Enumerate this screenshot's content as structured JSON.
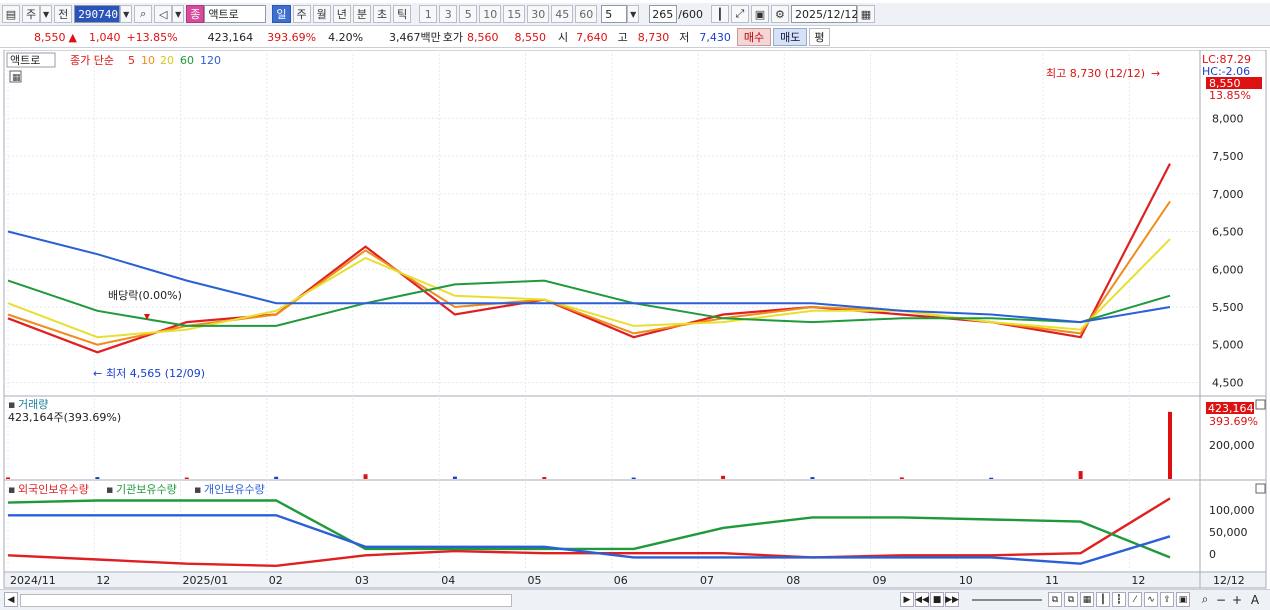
{
  "toolbar": {
    "market": "주",
    "prev_label": "전",
    "code": "290740",
    "name_badge": "종",
    "stock_name": "액트로",
    "periods": [
      "일",
      "주",
      "월",
      "년",
      "분",
      "초",
      "틱"
    ],
    "active_period": "일",
    "minute_steps": [
      "1",
      "3",
      "5",
      "10",
      "15",
      "30",
      "45",
      "60"
    ],
    "interval_value": "5",
    "count": "265",
    "count_total": "/600",
    "date": "2025/12/12"
  },
  "quote": {
    "price": "8,550",
    "change": "1,040",
    "change_pct": "+13.85%",
    "volume": "423,164",
    "volume_ratio": "393.69%",
    "turnover_rate": "4.20%",
    "amount": "3,467백만",
    "ask_label": "호가",
    "ask": "8,560",
    "bid": "8,550",
    "open_label": "시",
    "open": "7,640",
    "high_label": "고",
    "high": "8,730",
    "low_label": "저",
    "low": "7,430",
    "buy_label": "매수",
    "sell_label": "매도",
    "avg_label": "평"
  },
  "price_panel": {
    "stock_label": "액트로",
    "legend_prefix": "종가 단순",
    "ma_periods": [
      {
        "label": "5",
        "color": "#e02020"
      },
      {
        "label": "10",
        "color": "#f08c1a"
      },
      {
        "label": "20",
        "color": "#e8e030"
      },
      {
        "label": "60",
        "color": "#1f9a3a"
      },
      {
        "label": "120",
        "color": "#2a5fd6"
      }
    ],
    "lc": "LC:87.29",
    "hc": "HC:-2.06",
    "price_tag": "8,550",
    "price_tag_pct": "13.85%",
    "annotation_high": "최고 8,730 (12/12)",
    "annotation_low": "최저 4,565 (12/09)",
    "annotation_dividend": "배당락(0.00%)",
    "y_ticks": [
      {
        "value": 8000,
        "label": "8,000"
      },
      {
        "value": 7500,
        "label": "7,500"
      },
      {
        "value": 7000,
        "label": "7,000"
      },
      {
        "value": 6500,
        "label": "6,500"
      },
      {
        "value": 6000,
        "label": "6,000"
      },
      {
        "value": 5500,
        "label": "5,500"
      },
      {
        "value": 5000,
        "label": "5,000"
      },
      {
        "value": 4500,
        "label": "4,500"
      }
    ]
  },
  "volume_panel": {
    "title": "거래량",
    "value_label": "423,164주(393.69%)",
    "tag": "423,164",
    "tag_pct": "393.69%",
    "y_tick": "200,000"
  },
  "holding_panel": {
    "legend": [
      {
        "label": "외국인보유수량",
        "color": "#e02020"
      },
      {
        "label": "기관보유수량",
        "color": "#1f9a3a"
      },
      {
        "label": "개인보유수량",
        "color": "#2a5fd6"
      }
    ],
    "y_ticks": [
      "100,000",
      "50,000",
      "0"
    ]
  },
  "x_axis": {
    "labels": [
      "2024/11",
      "12",
      "2025/01",
      "02",
      "03",
      "04",
      "05",
      "06",
      "07",
      "08",
      "09",
      "10",
      "11",
      "12"
    ],
    "right_label": "12/12"
  },
  "colors": {
    "up": "#d11",
    "down": "#1a3fcf",
    "ma5": "#e02020",
    "ma10": "#f08c1a",
    "ma20": "#e8e030",
    "ma60": "#1f9a3a",
    "ma120": "#2a5fd6"
  },
  "chart_data": {
    "type": "line",
    "title": "액트로",
    "x_range": [
      "2024/11",
      "2025/12/12"
    ],
    "price_range": [
      4400,
      8800
    ],
    "series": [
      {
        "name": "5",
        "x": [
          "2024/11",
          "2024/12",
          "2025/01",
          "2025/02",
          "2025/03",
          "2025/04",
          "2025/05",
          "2025/06",
          "2025/07",
          "2025/08",
          "2025/09",
          "2025/10",
          "2025/11",
          "2025/12/12"
        ],
        "values": [
          5350,
          4900,
          5300,
          5400,
          6300,
          5400,
          5600,
          5100,
          5400,
          5500,
          5400,
          5300,
          5100,
          7400
        ]
      },
      {
        "name": "10",
        "x": [
          "2024/11",
          "2024/12",
          "2025/01",
          "2025/02",
          "2025/03",
          "2025/04",
          "2025/05",
          "2025/06",
          "2025/07",
          "2025/08",
          "2025/09",
          "2025/10",
          "2025/11",
          "2025/12/12"
        ],
        "values": [
          5400,
          5000,
          5250,
          5400,
          6250,
          5500,
          5600,
          5150,
          5350,
          5500,
          5450,
          5300,
          5150,
          6900
        ]
      },
      {
        "name": "20",
        "x": [
          "2024/11",
          "2024/12",
          "2025/01",
          "2025/02",
          "2025/03",
          "2025/04",
          "2025/05",
          "2025/06",
          "2025/07",
          "2025/08",
          "2025/09",
          "2025/10",
          "2025/11",
          "2025/12/12"
        ],
        "values": [
          5550,
          5100,
          5200,
          5450,
          6150,
          5650,
          5600,
          5250,
          5300,
          5450,
          5450,
          5300,
          5200,
          6400
        ]
      },
      {
        "name": "60",
        "x": [
          "2024/11",
          "2024/12",
          "2025/01",
          "2025/02",
          "2025/03",
          "2025/04",
          "2025/05",
          "2025/06",
          "2025/07",
          "2025/08",
          "2025/09",
          "2025/10",
          "2025/11",
          "2025/12/12"
        ],
        "values": [
          5850,
          5450,
          5250,
          5250,
          5550,
          5800,
          5850,
          5550,
          5350,
          5300,
          5350,
          5350,
          5300,
          5650
        ]
      },
      {
        "name": "120",
        "x": [
          "2024/11",
          "2024/12",
          "2025/01",
          "2025/02",
          "2025/03",
          "2025/04",
          "2025/05",
          "2025/06",
          "2025/07",
          "2025/08",
          "2025/09",
          "2025/10",
          "2025/11",
          "2025/12/12"
        ],
        "values": [
          6500,
          6200,
          5850,
          5550,
          5550,
          5550,
          5550,
          5550,
          5550,
          5550,
          5450,
          5400,
          5300,
          5500
        ]
      }
    ],
    "volume": {
      "categories": [
        "2024/11",
        "2024/12",
        "2025/01",
        "2025/02",
        "2025/03",
        "2025/04",
        "2025/05",
        "2025/06",
        "2025/07",
        "2025/08",
        "2025/09",
        "2025/10",
        "2025/11",
        "2025/12/12"
      ],
      "values": [
        10000,
        12000,
        9000,
        14000,
        30000,
        15000,
        12000,
        9000,
        20000,
        12000,
        10000,
        8000,
        50000,
        423164
      ],
      "ylim": [
        0,
        460000
      ]
    },
    "holdings": {
      "categories": [
        "2024/11",
        "2024/12",
        "2025/01",
        "2025/02",
        "2025/03",
        "2025/04",
        "2025/05",
        "2025/06",
        "2025/07",
        "2025/08",
        "2025/09",
        "2025/10",
        "2025/11",
        "2025/12/12"
      ],
      "series": [
        {
          "name": "외국인보유수량",
          "values": [
            5000,
            -5000,
            -15000,
            -20000,
            5000,
            15000,
            10000,
            10000,
            10000,
            0,
            5000,
            5000,
            10000,
            140000
          ]
        },
        {
          "name": "기관보유수량",
          "values": [
            130000,
            135000,
            135000,
            135000,
            20000,
            20000,
            20000,
            20000,
            70000,
            95000,
            95000,
            90000,
            85000,
            0
          ]
        },
        {
          "name": "개인보유수량",
          "values": [
            100000,
            100000,
            100000,
            100000,
            25000,
            25000,
            25000,
            0,
            0,
            0,
            0,
            0,
            -15000,
            50000
          ]
        }
      ],
      "ylim": [
        -30000,
        160000
      ]
    }
  }
}
